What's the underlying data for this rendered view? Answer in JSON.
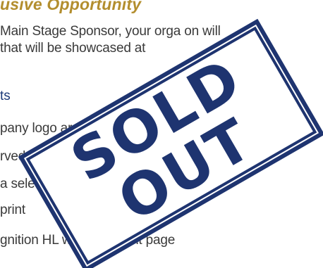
{
  "document": {
    "heading": "usive Opportunity",
    "intro_line_1": "Main Stage Sponsor, your orga          on will",
    "intro_line_2": "that will be showcased at",
    "benefits_heading": "ts",
    "benefit_1": "pany logo                                        ar the",
    "benefit_2": "rved                                     ng for eight (8",
    "benefit_3": "a                            select event mate",
    "benefit_4": "print",
    "benefit_5": "gnition        HL website event page",
    "benefit_6": ""
  },
  "stamp": {
    "text": "SOLD OUT",
    "color": "#1e3470"
  },
  "colors": {
    "heading": "#b38e2e",
    "subheading": "#1c3a78",
    "body": "#3a3a3a"
  }
}
